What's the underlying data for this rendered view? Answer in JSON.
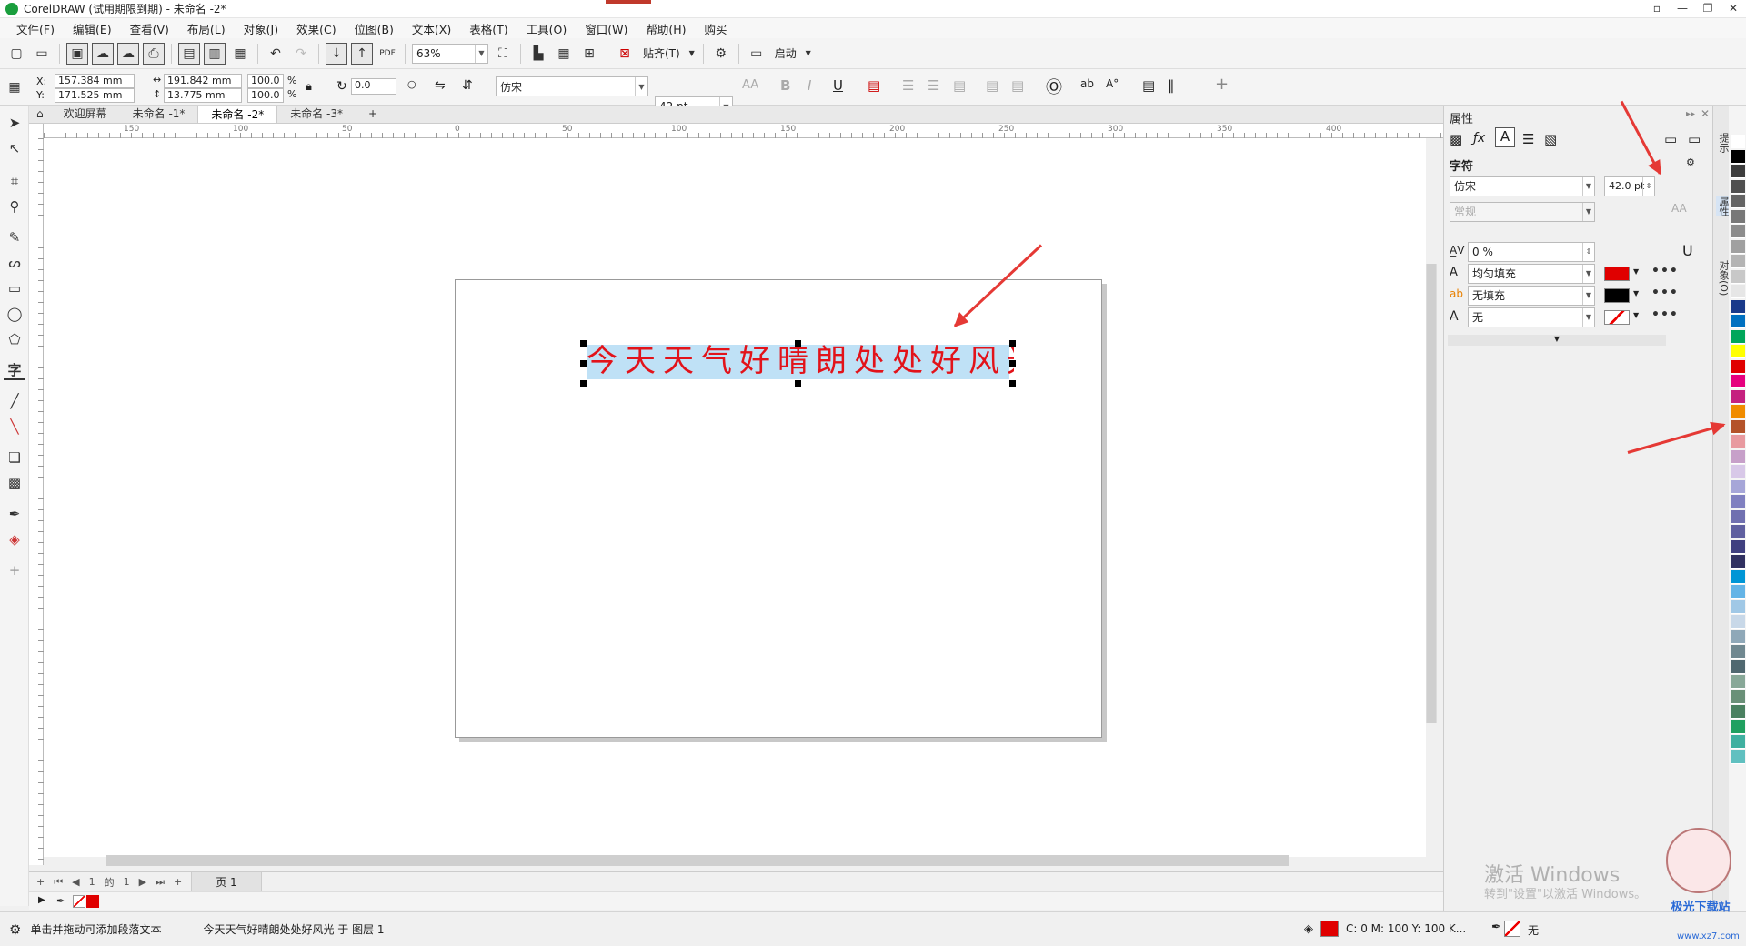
{
  "window": {
    "title": "CorelDRAW (试用期限到期) - 未命名 -2*",
    "controls": [
      "▫",
      "—",
      "❐",
      "✕"
    ]
  },
  "menu": [
    "文件(F)",
    "编辑(E)",
    "查看(V)",
    "布局(L)",
    "对象(J)",
    "效果(C)",
    "位图(B)",
    "文本(X)",
    "表格(T)",
    "工具(O)",
    "窗口(W)",
    "帮助(H)",
    "购买"
  ],
  "toolbar": {
    "zoom": "63%",
    "snap_label": "贴齐(T)",
    "launch_label": "启动"
  },
  "textbar": {
    "x": "157.384 mm",
    "y": "171.525 mm",
    "width": "191.842 mm",
    "height": "13.775 mm",
    "scale_x": "100.0",
    "scale_y": "100.0",
    "percent": "%",
    "rotation": "0.0",
    "font": "仿宋",
    "size": "42 pt",
    "x_label": "X:",
    "y_label": "Y:"
  },
  "tabs": [
    "欢迎屏幕",
    "未命名 -1*",
    "未命名 -2*",
    "未命名 -3*"
  ],
  "active_tab": 2,
  "ruler": {
    "ticks": [
      "150",
      "100",
      "50",
      "0",
      "50",
      "100",
      "150",
      "200",
      "250",
      "300",
      "350",
      "400"
    ]
  },
  "canvas": {
    "text": "今天天气好晴朗处处好风光",
    "text_color": "#e2131a",
    "selection_color": "#bfe1f6"
  },
  "pagenav": {
    "current": "1",
    "of": "的",
    "total": "1",
    "page_tab": "页 1"
  },
  "properties": {
    "title": "属性",
    "section": "字符",
    "font": "仿宋",
    "style": "常规",
    "size": "42.0 pt",
    "kerning": "0 %",
    "fill_label": "均匀填充",
    "fill_color": "#e00000",
    "bg_label": "无填充",
    "bg_color": "#000000",
    "outline_label": "无"
  },
  "docker_tabs": [
    "提示",
    "属性",
    "对象(O)"
  ],
  "status": {
    "hint": "单击并拖动可添加段落文本",
    "selection": "今天天气好晴朗处处好风光 于 图层 1",
    "cmyk": "C: 0 M: 100 Y: 100 K...",
    "outline": "无"
  },
  "watermark": {
    "line1": "激活 Windows",
    "line2": "转到\"设置\"以激活 Windows。",
    "brand": "极光下载站",
    "site": "www.xz7.com"
  },
  "palette": [
    "#ffffff",
    "#000000",
    "#3c3c3c",
    "#505050",
    "#646464",
    "#787878",
    "#8c8c8c",
    "#a0a0a0",
    "#b4b4b4",
    "#c8c8c8",
    "#e6e6e6",
    "#1a3a8a",
    "#0070c0",
    "#00a65a",
    "#ffff00",
    "#e00000",
    "#e6007e",
    "#c5217f",
    "#f08c00",
    "#b4532a",
    "#e89aa0",
    "#c7a0c9",
    "#d8c8e8",
    "#a6a6d8",
    "#8080c0",
    "#7070b0",
    "#6060a0",
    "#404080",
    "#303060",
    "#0096d6",
    "#64b4e6",
    "#a0c8e6",
    "#c8d8e8",
    "#8fa8b8",
    "#708890",
    "#506870",
    "#88a898",
    "#6a9078",
    "#4a8060",
    "#20a060",
    "#40b0a0",
    "#60c0c0"
  ]
}
